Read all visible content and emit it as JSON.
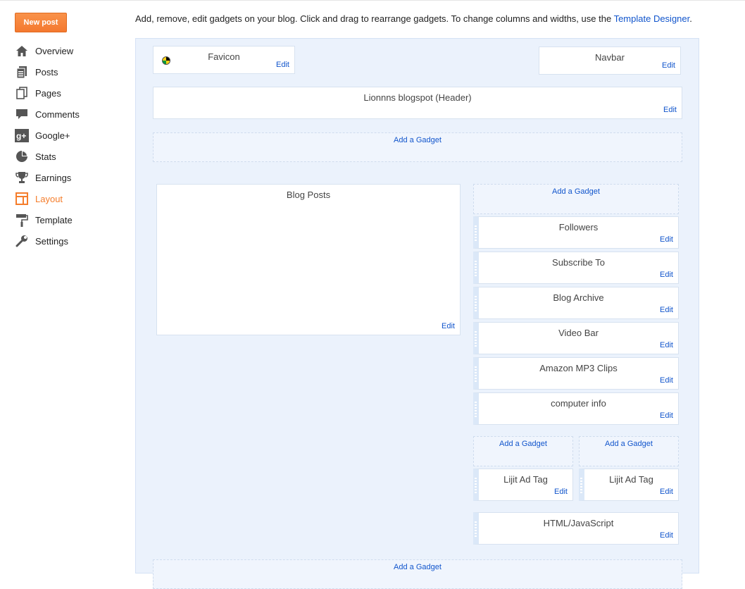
{
  "sidebar": {
    "new_post_label": "New post",
    "items": [
      {
        "label": "Overview",
        "icon": "home-icon"
      },
      {
        "label": "Posts",
        "icon": "posts-icon"
      },
      {
        "label": "Pages",
        "icon": "pages-icon"
      },
      {
        "label": "Comments",
        "icon": "comments-icon"
      },
      {
        "label": "Google+",
        "icon": "google-plus-icon"
      },
      {
        "label": "Stats",
        "icon": "stats-icon"
      },
      {
        "label": "Earnings",
        "icon": "trophy-icon"
      },
      {
        "label": "Layout",
        "icon": "layout-icon",
        "active": true
      },
      {
        "label": "Template",
        "icon": "paint-roller-icon"
      },
      {
        "label": "Settings",
        "icon": "wrench-icon"
      }
    ],
    "active_color": "#f57d2b"
  },
  "header": {
    "intro_text": "Add, remove, edit gadgets on your blog. Click and drag to rearrange gadgets. To change columns and widths, use the",
    "template_designer_link": "Template Designer",
    "period": "."
  },
  "layout": {
    "favicon": {
      "title": "Favicon",
      "edit": "Edit"
    },
    "navbar": {
      "title": "Navbar",
      "edit": "Edit"
    },
    "header_gadget": {
      "title": "Lionnns blogspot (Header)",
      "edit": "Edit"
    },
    "add_gadget_label": "Add a Gadget",
    "blog_posts": {
      "title": "Blog Posts",
      "edit": "Edit"
    },
    "sidebar_gadgets": [
      {
        "title": "Followers",
        "edit": "Edit"
      },
      {
        "title": "Subscribe To",
        "edit": "Edit"
      },
      {
        "title": "Blog Archive",
        "edit": "Edit"
      },
      {
        "title": "Video Bar",
        "edit": "Edit"
      },
      {
        "title": "Amazon MP3 Clips",
        "edit": "Edit"
      },
      {
        "title": "computer info",
        "edit": "Edit"
      }
    ],
    "lijit_left": {
      "title": "Lijit Ad Tag",
      "edit": "Edit"
    },
    "lijit_right": {
      "title": "Lijit Ad Tag",
      "edit": "Edit"
    },
    "html_js": {
      "title": "HTML/JavaScript",
      "edit": "Edit"
    }
  }
}
